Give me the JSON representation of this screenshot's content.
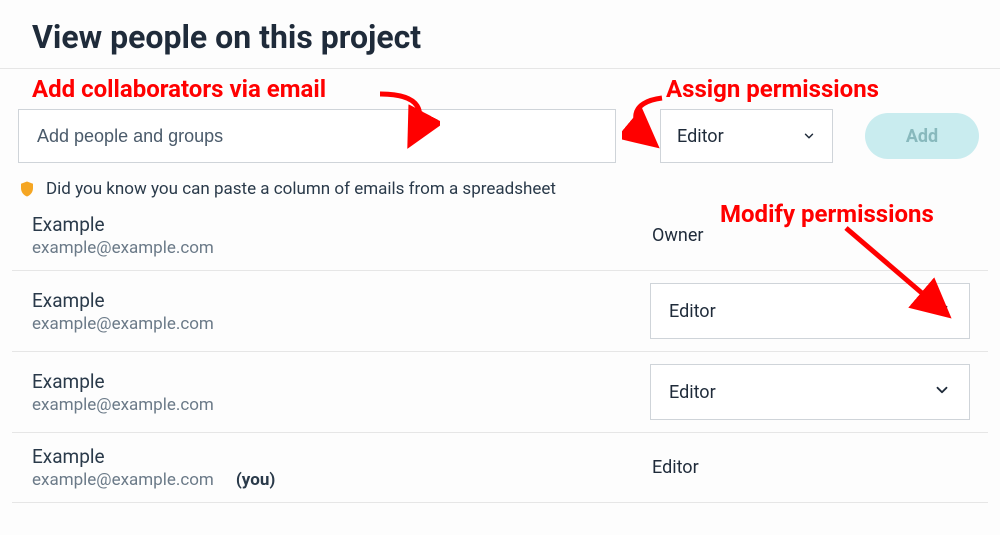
{
  "title": "View people on this project",
  "add_section": {
    "input_placeholder": "Add people and groups",
    "role_default": "Editor",
    "add_button_label": "Add"
  },
  "tip": {
    "text": "Did you know you can paste a column of emails from a spreadsheet"
  },
  "people": [
    {
      "name": "Example",
      "email": "example@example.com",
      "role": "Owner",
      "role_editable": false,
      "is_you": false
    },
    {
      "name": "Example",
      "email": "example@example.com",
      "role": "Editor",
      "role_editable": true,
      "is_you": false
    },
    {
      "name": "Example",
      "email": "example@example.com",
      "role": "Editor",
      "role_editable": true,
      "is_you": false
    },
    {
      "name": "Example",
      "email": "example@example.com",
      "role": "Editor",
      "role_editable": false,
      "is_you": true
    }
  ],
  "you_label": "(you)",
  "annotations": {
    "add_collab": "Add collaborators via email",
    "assign_perm": "Assign permissions",
    "modify_perm": "Modify permissions"
  }
}
